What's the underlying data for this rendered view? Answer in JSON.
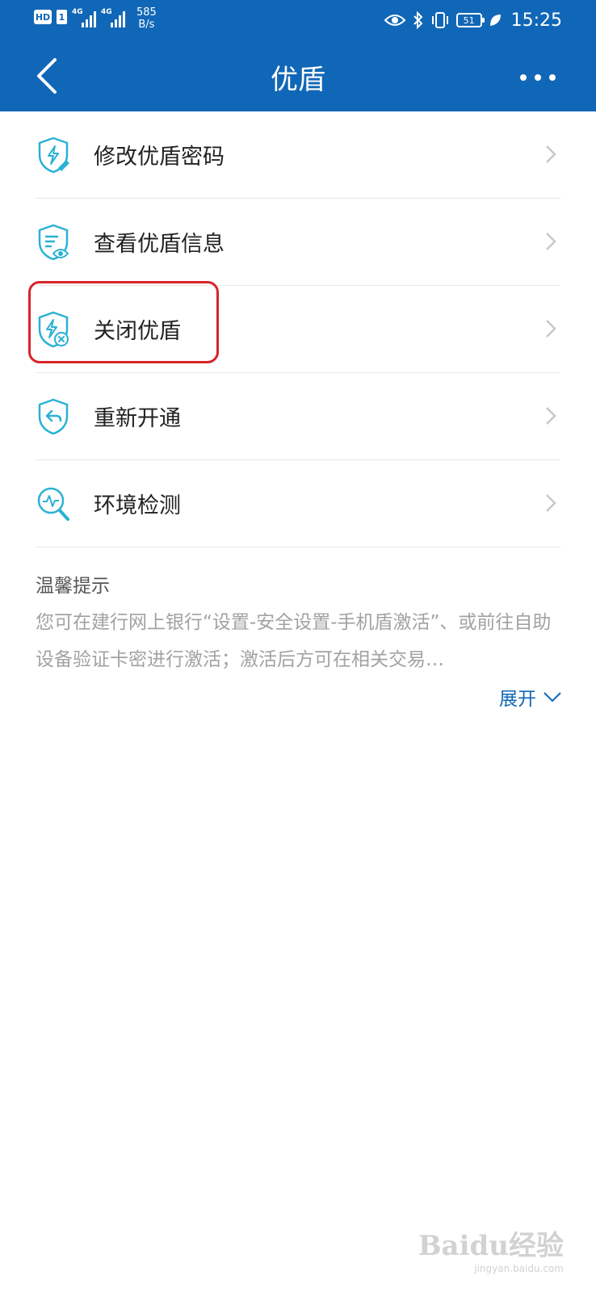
{
  "status_bar": {
    "hd_label": "HD",
    "sim_label": "1",
    "net1": "4G",
    "net2": "4G",
    "speed_value": "585",
    "speed_unit": "B/s",
    "battery": "51",
    "time": "15:25"
  },
  "header": {
    "title": "优盾",
    "background_color": "#1167b7"
  },
  "menu": {
    "items": [
      {
        "label": "修改优盾密码",
        "icon": "shield-edit-icon"
      },
      {
        "label": "查看优盾信息",
        "icon": "shield-view-icon"
      },
      {
        "label": "关闭优盾",
        "icon": "shield-close-icon"
      },
      {
        "label": "重新开通",
        "icon": "shield-reopen-icon"
      },
      {
        "label": "环境检测",
        "icon": "environment-scan-icon"
      }
    ],
    "highlighted_index": 2,
    "highlight_color": "#d8232a",
    "icon_color": "#2ab1d4"
  },
  "tips": {
    "title": "温馨提示",
    "body": "您可在建行网上银行“设置-安全设置-手机盾激活”、或前往自助设备验证卡密进行激活；激活后方可在相关交易…",
    "expand_label": "展开"
  },
  "watermark": {
    "brand": "Baidu经验",
    "url": "jingyan.baidu.com"
  }
}
